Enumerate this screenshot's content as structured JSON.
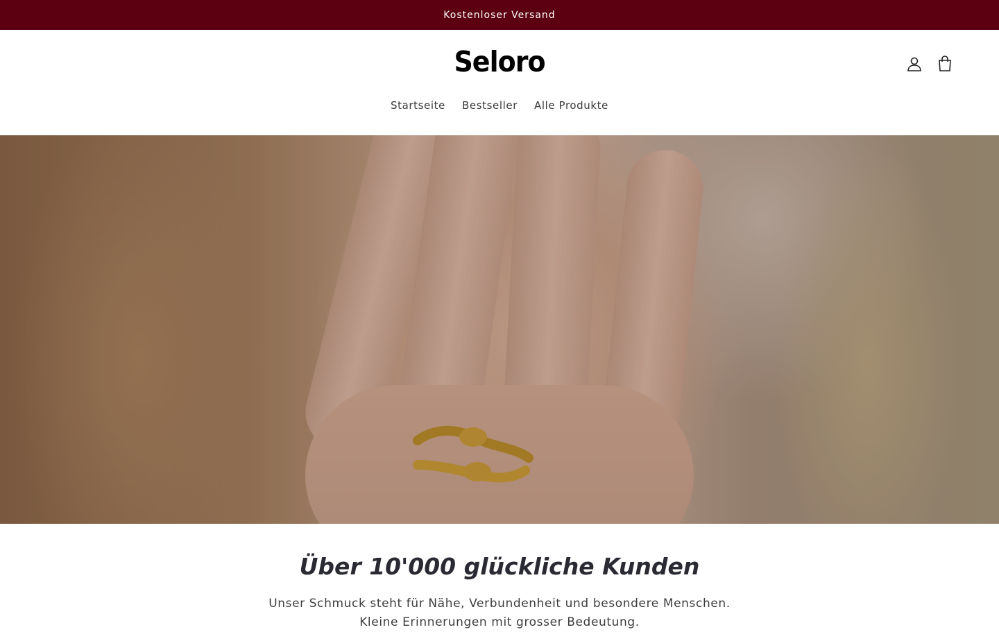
{
  "announcement": {
    "text": "Kostenloser Versand"
  },
  "header": {
    "logo": "Seloro",
    "nav": [
      {
        "label": "Startseite"
      },
      {
        "label": "Bestseller"
      },
      {
        "label": "Alle Produkte"
      }
    ],
    "icons": [
      "account-icon",
      "cart-icon"
    ]
  },
  "hero": {
    "image": "hand-with-hug-ring-photo"
  },
  "intro": {
    "headline": "Über 10'000 glückliche Kunden",
    "text": "Unser Schmuck steht für Nähe, Verbundenheit und besondere Menschen. Kleine Erinnerungen mit grosser Bedeutung."
  },
  "colors": {
    "announcement_bg": "#5c0011",
    "announcement_text": "#ffffff",
    "text": "#121212",
    "heading": "#2a2a33"
  }
}
